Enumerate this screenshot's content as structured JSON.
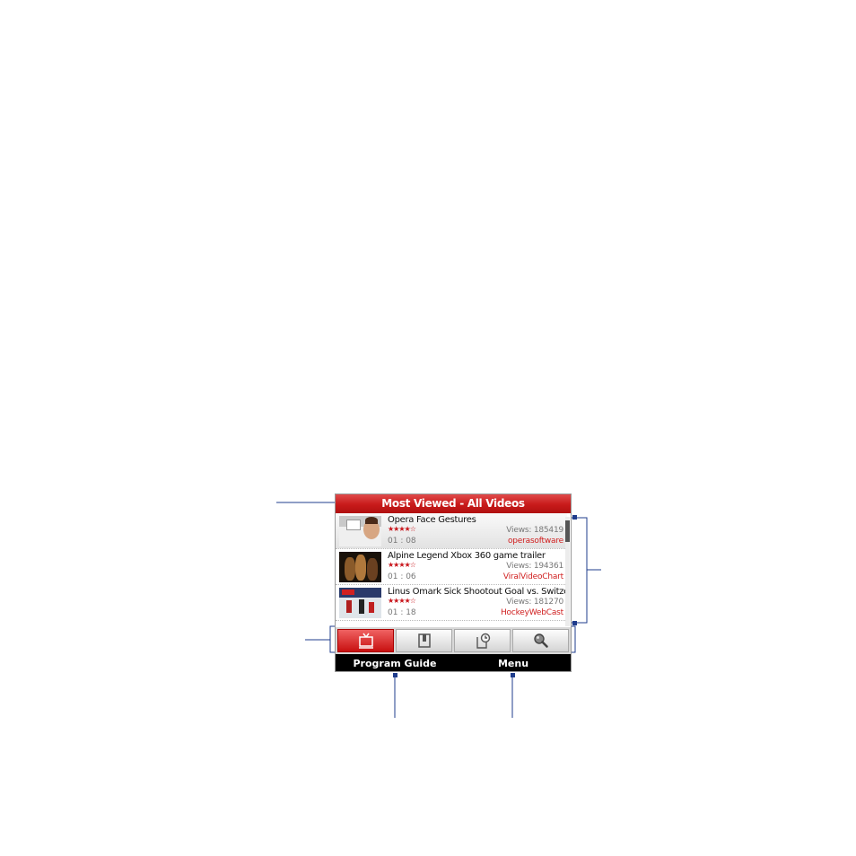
{
  "header": {
    "title": "Most Viewed - All Videos"
  },
  "videos": [
    {
      "title": "Opera Face Gestures",
      "rating_stars": "★★★★☆",
      "rating": 4.5,
      "views": "Views: 185419",
      "duration": "01 : 08",
      "author": "operasoftware",
      "selected": true
    },
    {
      "title": "Alpine Legend  Xbox 360 game trailer",
      "rating_stars": "★★★★☆",
      "rating": 4.5,
      "views": "Views: 194361",
      "duration": "01 : 06",
      "author": "ViralVideoChart",
      "selected": false
    },
    {
      "title": "Linus Omark Sick Shootout Goal vs. Switzerlan...",
      "rating_stars": "★★★★☆",
      "rating": 4.5,
      "views": "Views: 181270",
      "duration": "01 : 18",
      "author": "HockeyWebCast",
      "selected": false
    }
  ],
  "tabs": [
    {
      "icon": "tv-icon",
      "active": true
    },
    {
      "icon": "bookmark-icon",
      "active": false
    },
    {
      "icon": "history-icon",
      "active": false
    },
    {
      "icon": "search-icon",
      "active": false
    }
  ],
  "soft_keys": {
    "left": "Program Guide",
    "right": "Menu"
  },
  "colors": {
    "accent": "#c8141a",
    "callout": "#1f3c8c"
  }
}
